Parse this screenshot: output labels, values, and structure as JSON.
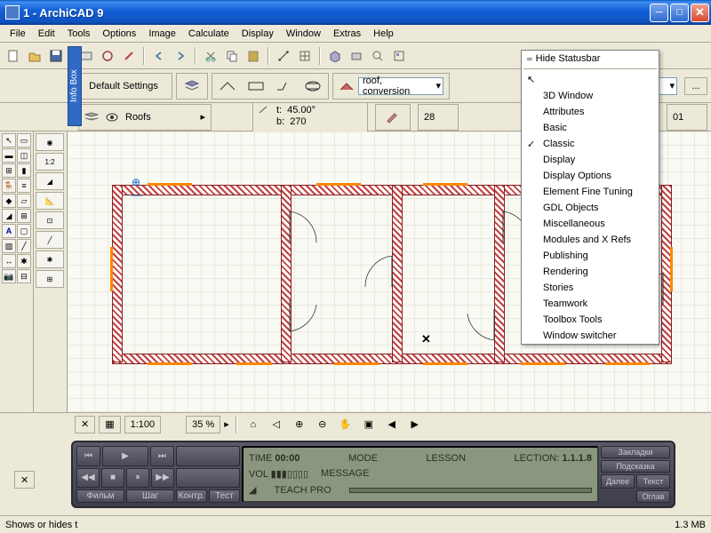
{
  "window": {
    "title": "1 - ArchiCAD 9"
  },
  "menu": [
    "File",
    "Edit",
    "Tools",
    "Options",
    "Image",
    "Calculate",
    "Display",
    "Window",
    "Extras",
    "Help"
  ],
  "infobox_label": "Info Box",
  "settings": {
    "default": "Default Settings",
    "layer": "Roofs",
    "combo1": "roof, conversion"
  },
  "params": {
    "angle_label": "t:",
    "angle": "45.00°",
    "b_label": "b:",
    "b_val": "270"
  },
  "dropdown": {
    "head": "Hide Statusbar",
    "items": [
      "3D Window",
      "Attributes",
      "Basic",
      "Classic",
      "Display",
      "Display Options",
      "Element Fine Tuning",
      "GDL Objects",
      "Miscellaneous",
      "Modules and X Refs",
      "Publishing",
      "Rendering",
      "Stories",
      "Teamwork",
      "Toolbox Tools",
      "Window switcher"
    ],
    "checked": 3
  },
  "bottom": {
    "scale": "1:100",
    "zoom": "35 %",
    "num": "28",
    "num2": "01"
  },
  "media": {
    "time_label": "TIME",
    "time": "00:00",
    "mode": "MODE",
    "lesson": "LESSON",
    "lection": "LECTION:",
    "lection_num": "1.1.1.8",
    "vol": "VOL",
    "message": "MESSAGE",
    "teach": "TEACH PRO",
    "tabs": [
      "Фильм",
      "Шаг",
      "Контр.",
      "Тест"
    ],
    "side": [
      "Закладки",
      "Подсказка",
      "Далее",
      "Текст",
      "Оглав"
    ]
  },
  "status": {
    "left": "Shows or hides t",
    "right": "1.3 MB"
  }
}
